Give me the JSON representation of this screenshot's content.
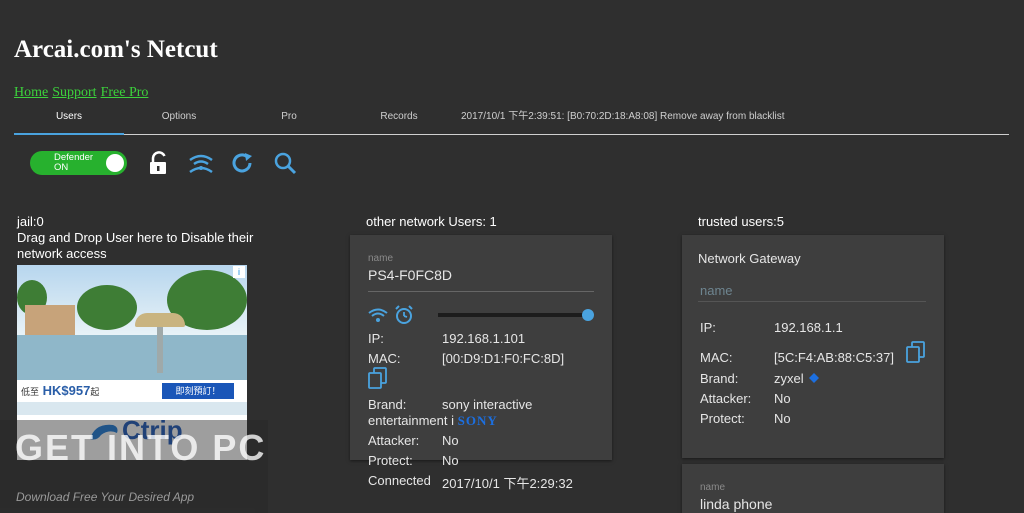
{
  "app": {
    "title": "Arcai.com's Netcut"
  },
  "links": [
    "Home",
    "Support",
    "Free Pro"
  ],
  "tabs": [
    "Users",
    "Options",
    "Pro",
    "Records"
  ],
  "status_message": "2017/10/1 下午2:39:51: [B0:70:2D:18:A8:08] Remove away from blacklist",
  "toolbar": {
    "defender_label": "Defender",
    "defender_state": "ON",
    "icons": [
      "unlock-icon",
      "network-scan-icon",
      "refresh-icon",
      "search-icon"
    ]
  },
  "jail": {
    "header": "jail:0",
    "description": "Drag and Drop User here to Disable their network access"
  },
  "ad": {
    "price_prefix": "低至",
    "price": "HK$957",
    "price_suffix": "起",
    "cta": "即刻預訂！",
    "brand": "Ctrip",
    "info": "i"
  },
  "watermark": {
    "text": "GET INTO PC",
    "sub": "Download Free Your Desired App"
  },
  "other_users": {
    "header": "other network Users: 1",
    "card": {
      "name_label": "name",
      "name": "PS4-F0FC8D",
      "slider_value": 1.0,
      "ip_label": "IP:",
      "ip": "192.168.1.101",
      "mac_label": "MAC:",
      "mac": "[00:D9:D1:F0:FC:8D]",
      "brand_label": "Brand:",
      "brand_line1": "sony interactive",
      "brand_line2": "entertainment i",
      "brand_logo": "SONY",
      "attacker_label": "Attacker:",
      "attacker": "No",
      "protect_label": "Protect:",
      "protect": "No",
      "connected_label": "Connected",
      "connected": "2017/10/1 下午2:29:32"
    }
  },
  "trusted_users": {
    "header": "trusted users:5",
    "gateway": {
      "title": "Network Gateway",
      "name_placeholder": "name",
      "ip_label": "IP:",
      "ip": "192.168.1.1",
      "mac_label": "MAC:",
      "mac": "[5C:F4:AB:88:C5:37]",
      "brand_label": "Brand:",
      "brand": "zyxel",
      "attacker_label": "Attacker:",
      "attacker": "No",
      "protect_label": "Protect:",
      "protect": "No"
    },
    "second": {
      "name_label": "name",
      "name": "linda phone"
    }
  },
  "colors": {
    "background": "#2f2f2f",
    "card": "#3e3e3e",
    "accent": "#4aa3df",
    "toggle_on": "#27b12e",
    "link": "#3cd23c"
  }
}
